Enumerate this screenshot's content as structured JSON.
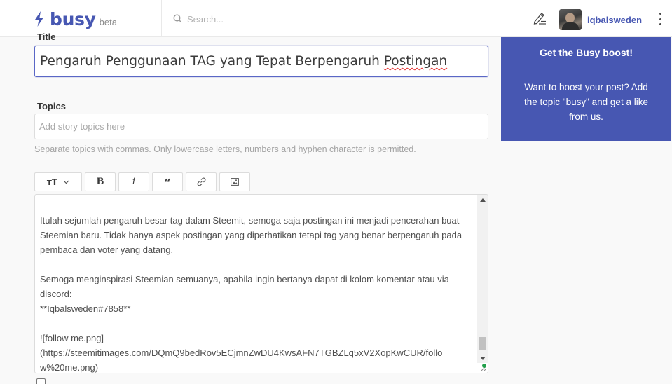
{
  "header": {
    "logo_name": "busy",
    "logo_tag": "beta",
    "search_placeholder": "Search...",
    "username": "iqbalsweden"
  },
  "editor": {
    "title_label": "Title",
    "title_value_main": "Pengaruh Penggunaan TAG yang Tepat Berpengaruh ",
    "title_value_misspelled": "Postingan",
    "topics_label": "Topics",
    "topics_placeholder": "Add story topics here",
    "topics_hint": "Separate topics with commas. Only lowercase letters, numbers and hyphen character is permitted.",
    "toolbar": {
      "heading_glyph": "ᴛT",
      "bold_glyph": "B",
      "italic_glyph": "i",
      "quote_glyph": "“",
      "link_icon": "link-icon",
      "image_icon": "image-icon"
    },
    "body_lines": [
      "Itulah sejumlah pengaruh besar tag dalam Steemit, semoga saja postingan ini menjadi pencerahan buat",
      "Steemian baru. Tidak hanya aspek postingan yang diperhatikan tetapi tag yang benar berpengaruh pada",
      "pembaca dan voter yang datang.",
      "",
      "Semoga menginspirasi Steemian semuanya, apabila ingin bertanya dapat di kolom komentar atau via",
      "discord:",
      "**Iqbalsweden#7858**",
      "",
      "![follow me.png]",
      "(https://steemitimages.com/DQmQ9bedRov5ECjmnZwDU4KwsAFN7TGBZLq5xV2XopKwCUR/follo",
      "w%20me.png)"
    ]
  },
  "sidebar": {
    "boost_title": "Get the Busy boost!",
    "boost_body": "Want to boost your post? Add the topic \"busy\" and get a like from us."
  },
  "colors": {
    "brand": "#4757b2",
    "focus_border": "#5a67c6",
    "spellcheck": "#e53030"
  }
}
